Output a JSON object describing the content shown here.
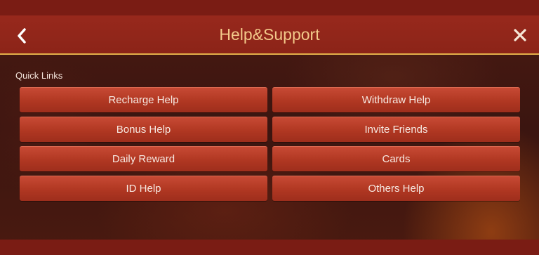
{
  "header": {
    "title": "Help&Support"
  },
  "quick_links": {
    "label": "Quick Links",
    "items": [
      {
        "label": "Recharge Help"
      },
      {
        "label": "Withdraw Help"
      },
      {
        "label": "Bonus Help"
      },
      {
        "label": "Invite Friends"
      },
      {
        "label": "Daily Reward"
      },
      {
        "label": "Cards"
      },
      {
        "label": "ID Help"
      },
      {
        "label": "Others Help"
      }
    ]
  },
  "icons": {
    "back": "chevron-left-icon",
    "close": "close-icon"
  },
  "colors": {
    "header_bg": "#9c2a1e",
    "header_border": "#e3b04a",
    "title_text": "#f3c98a",
    "button_bg": "#b03722",
    "button_text": "#f6e9e2"
  }
}
